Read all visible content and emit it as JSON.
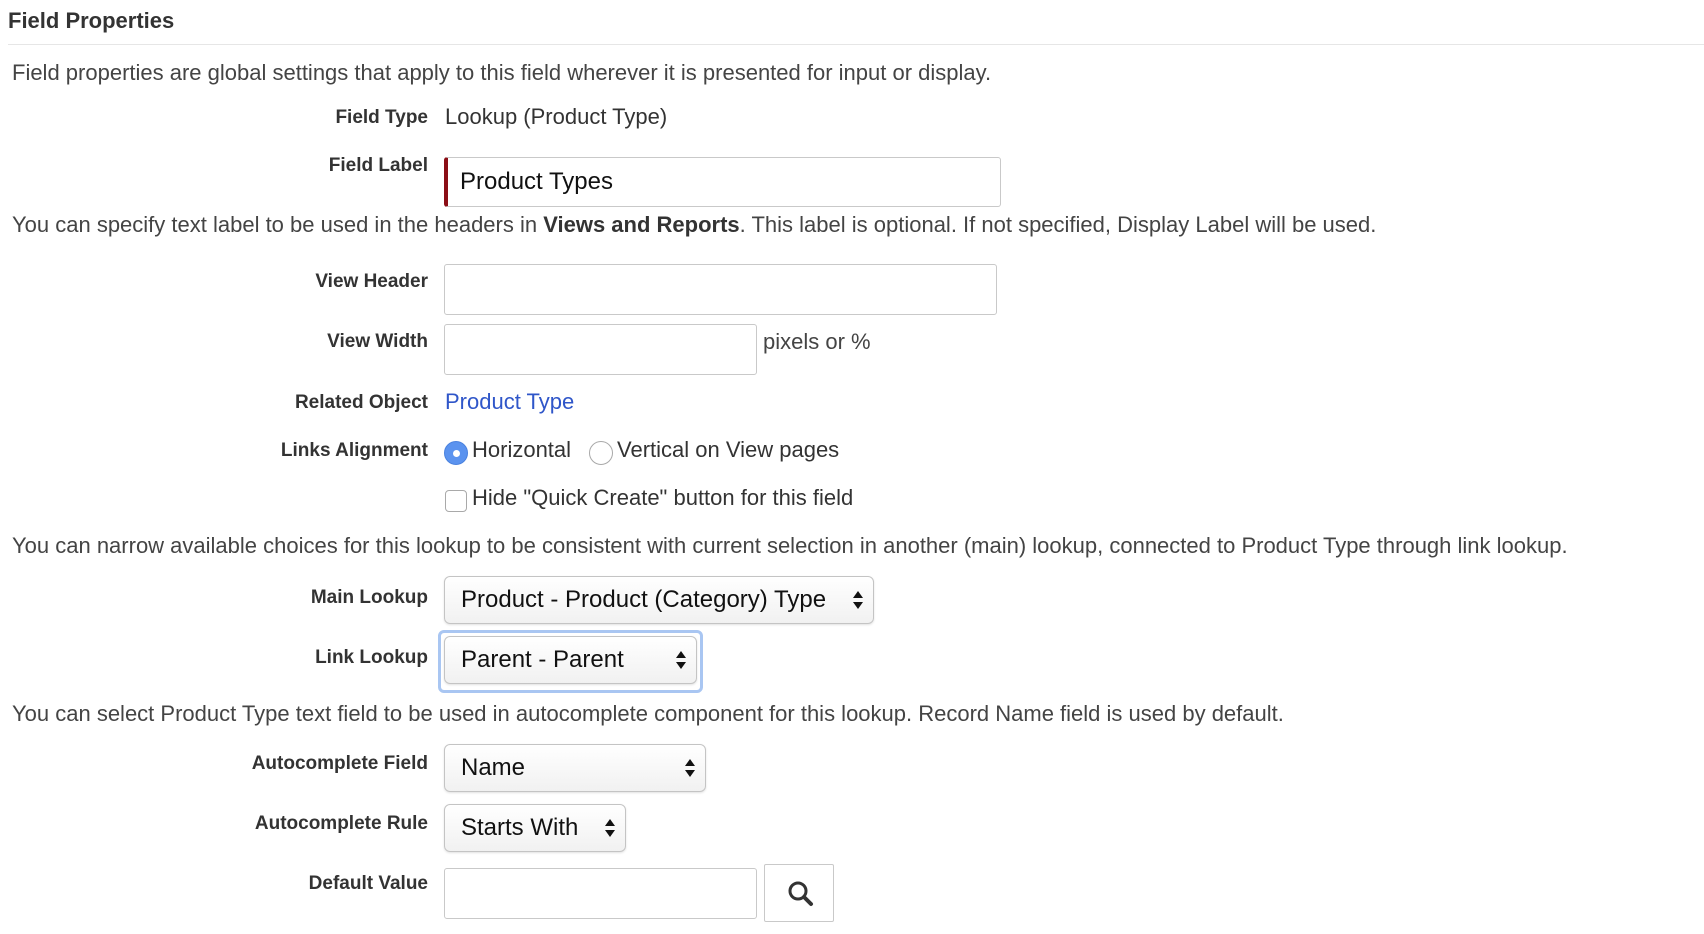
{
  "section": {
    "title": "Field Properties"
  },
  "intro": "Field properties are global settings that apply to this field wherever it is presented for input or display.",
  "field_type": {
    "label": "Field Type",
    "value": "Lookup (Product Type)"
  },
  "field_label": {
    "label": "Field Label",
    "value": "Product Types"
  },
  "views_desc": {
    "before": "You can specify text label to be used in the headers in ",
    "bold": "Views and Reports",
    "after": ". This label is optional. If not specified, Display Label will be used."
  },
  "view_header": {
    "label": "View Header",
    "value": ""
  },
  "view_width": {
    "label": "View Width",
    "value": "",
    "suffix": "pixels or %"
  },
  "related_object": {
    "label": "Related Object",
    "value": "Product Type"
  },
  "links_alignment": {
    "label": "Links Alignment",
    "options": [
      {
        "label": "Horizontal",
        "selected": true
      },
      {
        "label": "Vertical on View pages",
        "selected": false
      }
    ]
  },
  "hide_quick_create": {
    "label": "Hide \"Quick Create\" button for this field",
    "checked": false
  },
  "narrow_desc": "You can narrow available choices for this lookup to be consistent with current selection in another (main) lookup, connected to Product Type through link lookup.",
  "main_lookup": {
    "label": "Main Lookup",
    "value": "Product - Product (Category) Type"
  },
  "link_lookup": {
    "label": "Link Lookup",
    "value": "Parent - Parent"
  },
  "autocomplete_desc": "You can select Product Type text field to be used in autocomplete component for this lookup. Record Name field is used by default.",
  "autocomplete_field": {
    "label": "Autocomplete Field",
    "value": "Name"
  },
  "autocomplete_rule": {
    "label": "Autocomplete Rule",
    "value": "Starts With"
  },
  "default_value": {
    "label": "Default Value",
    "value": ""
  },
  "icons": {
    "search": "search-icon",
    "select_arrows": "up-down-arrows-icon"
  },
  "colors": {
    "link": "#2f56c9",
    "required_marker": "#8b0e16",
    "radio_selected": "#5b93ef",
    "focus_ring": "#a9c6f2"
  }
}
